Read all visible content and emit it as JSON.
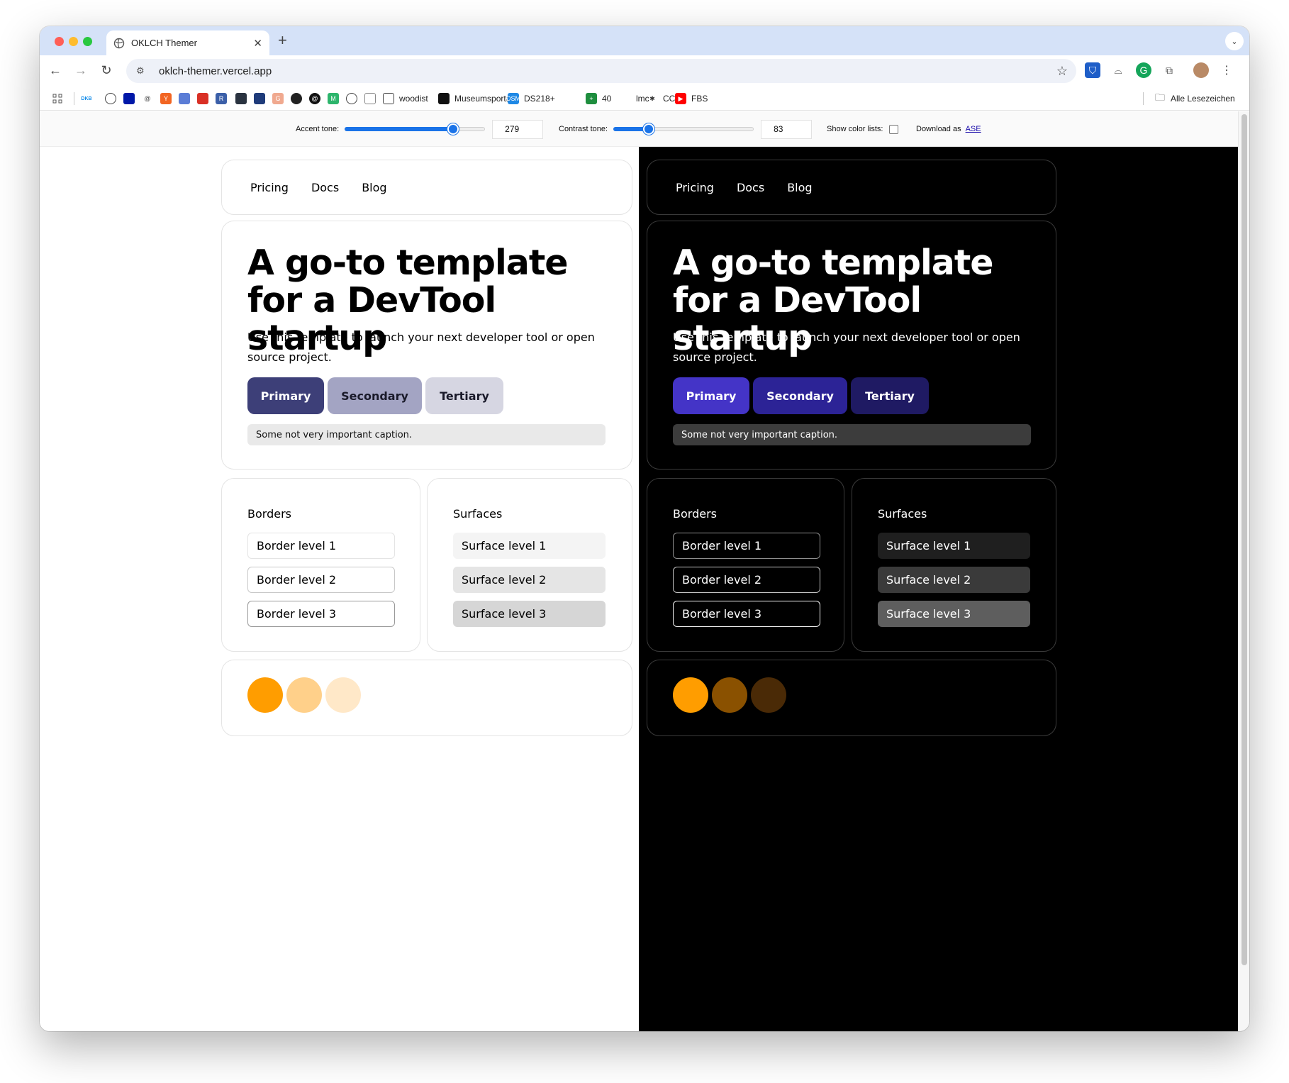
{
  "browser": {
    "tab_title": "OKLCH Themer",
    "tab_close": "✕",
    "new_tab": "+",
    "url": "oklch-themer.vercel.app",
    "bookmarks": [
      {
        "label": "",
        "icon": "dkb-icon",
        "color": "#ffffff",
        "text": "DKB"
      },
      {
        "label": "",
        "icon": "globe-icon",
        "color": "#444444",
        "text": ""
      },
      {
        "label": "",
        "icon": "deutsche-bank-icon",
        "color": "#0018a8",
        "text": ""
      },
      {
        "label": "",
        "icon": "at-sign-icon",
        "color": "#444444",
        "text": "@"
      },
      {
        "label": "",
        "icon": "ycombinator-icon",
        "color": "#f26522",
        "text": "Y"
      },
      {
        "label": "",
        "icon": "clock-icon",
        "color": "#5b7dd6",
        "text": ""
      },
      {
        "label": "",
        "icon": "glasses-icon",
        "color": "#d93025",
        "text": ""
      },
      {
        "label": "",
        "icon": "r-icon",
        "color": "#3b5fa8",
        "text": "R"
      },
      {
        "label": "",
        "icon": "dots-icon",
        "color": "#2a3340",
        "text": ""
      },
      {
        "label": "",
        "icon": "diagonal-icon",
        "color": "#1f3b7a",
        "text": ""
      },
      {
        "label": "",
        "icon": "g-icon",
        "color": "#f0a98f",
        "text": "G"
      },
      {
        "label": "",
        "icon": "circle-icon",
        "color": "#222222",
        "text": ""
      },
      {
        "label": "",
        "icon": "threads-icon",
        "color": "#111111",
        "text": "@"
      },
      {
        "label": "",
        "icon": "m-icon",
        "color": "#2db56c",
        "text": "M"
      },
      {
        "label": "",
        "icon": "globe-icon",
        "color": "#444444",
        "text": ""
      },
      {
        "label": "",
        "icon": "search-box-icon",
        "color": "#888888",
        "text": ""
      },
      {
        "label": "woodist",
        "icon": "folder-icon",
        "color": "#444444",
        "text": ""
      },
      {
        "label": "Museumsportal",
        "icon": "square-icon",
        "color": "#111111",
        "text": ""
      },
      {
        "label": "DS218+",
        "icon": "dsm-icon",
        "color": "#1e88e5",
        "text": "DSM"
      },
      {
        "label": "40",
        "icon": "sheets-icon",
        "color": "#1e8e3e",
        "text": "+"
      },
      {
        "label": "lmc",
        "icon": "pencil-icon",
        "color": "#b8860b",
        "text": ""
      },
      {
        "label": "CC",
        "icon": "asterisk-icon",
        "color": "#333333",
        "text": "✱"
      },
      {
        "label": "FBS",
        "icon": "youtube-icon",
        "color": "#ff0000",
        "text": "▶"
      }
    ],
    "all_bookmarks": "Alle Lesezeichen"
  },
  "controls": {
    "accent_label": "Accent tone:",
    "accent_value": "279",
    "accent_fraction": 0.77,
    "contrast_label": "Contrast tone:",
    "contrast_value": "83",
    "contrast_fraction": 0.25,
    "show_lists_label": "Show color lists:",
    "show_lists_checked": false,
    "download_label": "Download as",
    "download_link": "ASE"
  },
  "preview": {
    "nav": [
      "Pricing",
      "Docs",
      "Blog"
    ],
    "headline": "A go-to template for a DevTool startup",
    "body": "Use this template to launch your next developer tool or open source project.",
    "buttons": [
      "Primary",
      "Secondary",
      "Tertiary"
    ],
    "caption": "Some not very important caption.",
    "borders_title": "Borders",
    "borders": [
      "Border level 1",
      "Border level 2",
      "Border level 3"
    ],
    "surfaces_title": "Surfaces",
    "surfaces": [
      "Surface level 1",
      "Surface level 2",
      "Surface level 3"
    ]
  },
  "colors": {
    "light": {
      "btn_bg": [
        "#3d3f78",
        "#a3a4c3",
        "#d6d6e2"
      ],
      "btn_fg": [
        "#ffffff",
        "#1a1a2a",
        "#1a1a2a"
      ],
      "border_levels": [
        "#e4e4e4",
        "#c8c8c8",
        "#9a9a9a"
      ],
      "surface_levels": [
        "#f4f4f4",
        "#e5e5e5",
        "#d6d6d6"
      ],
      "swatches": [
        "#ff9d00",
        "#ffd08a",
        "#ffe8c8"
      ]
    },
    "dark": {
      "btn_bg": [
        "#4434c7",
        "#2c2396",
        "#1f1a63"
      ],
      "btn_fg": [
        "#ffffff",
        "#ffffff",
        "#ffffff"
      ],
      "border_levels": [
        "#8e8e8e",
        "#c4c4c4",
        "#f2f2f2"
      ],
      "surface_levels": [
        "#1f1f1f",
        "#3a3a3a",
        "#5e5e5e"
      ],
      "swatches": [
        "#ff9d00",
        "#8a5100",
        "#4a2a06"
      ]
    }
  }
}
